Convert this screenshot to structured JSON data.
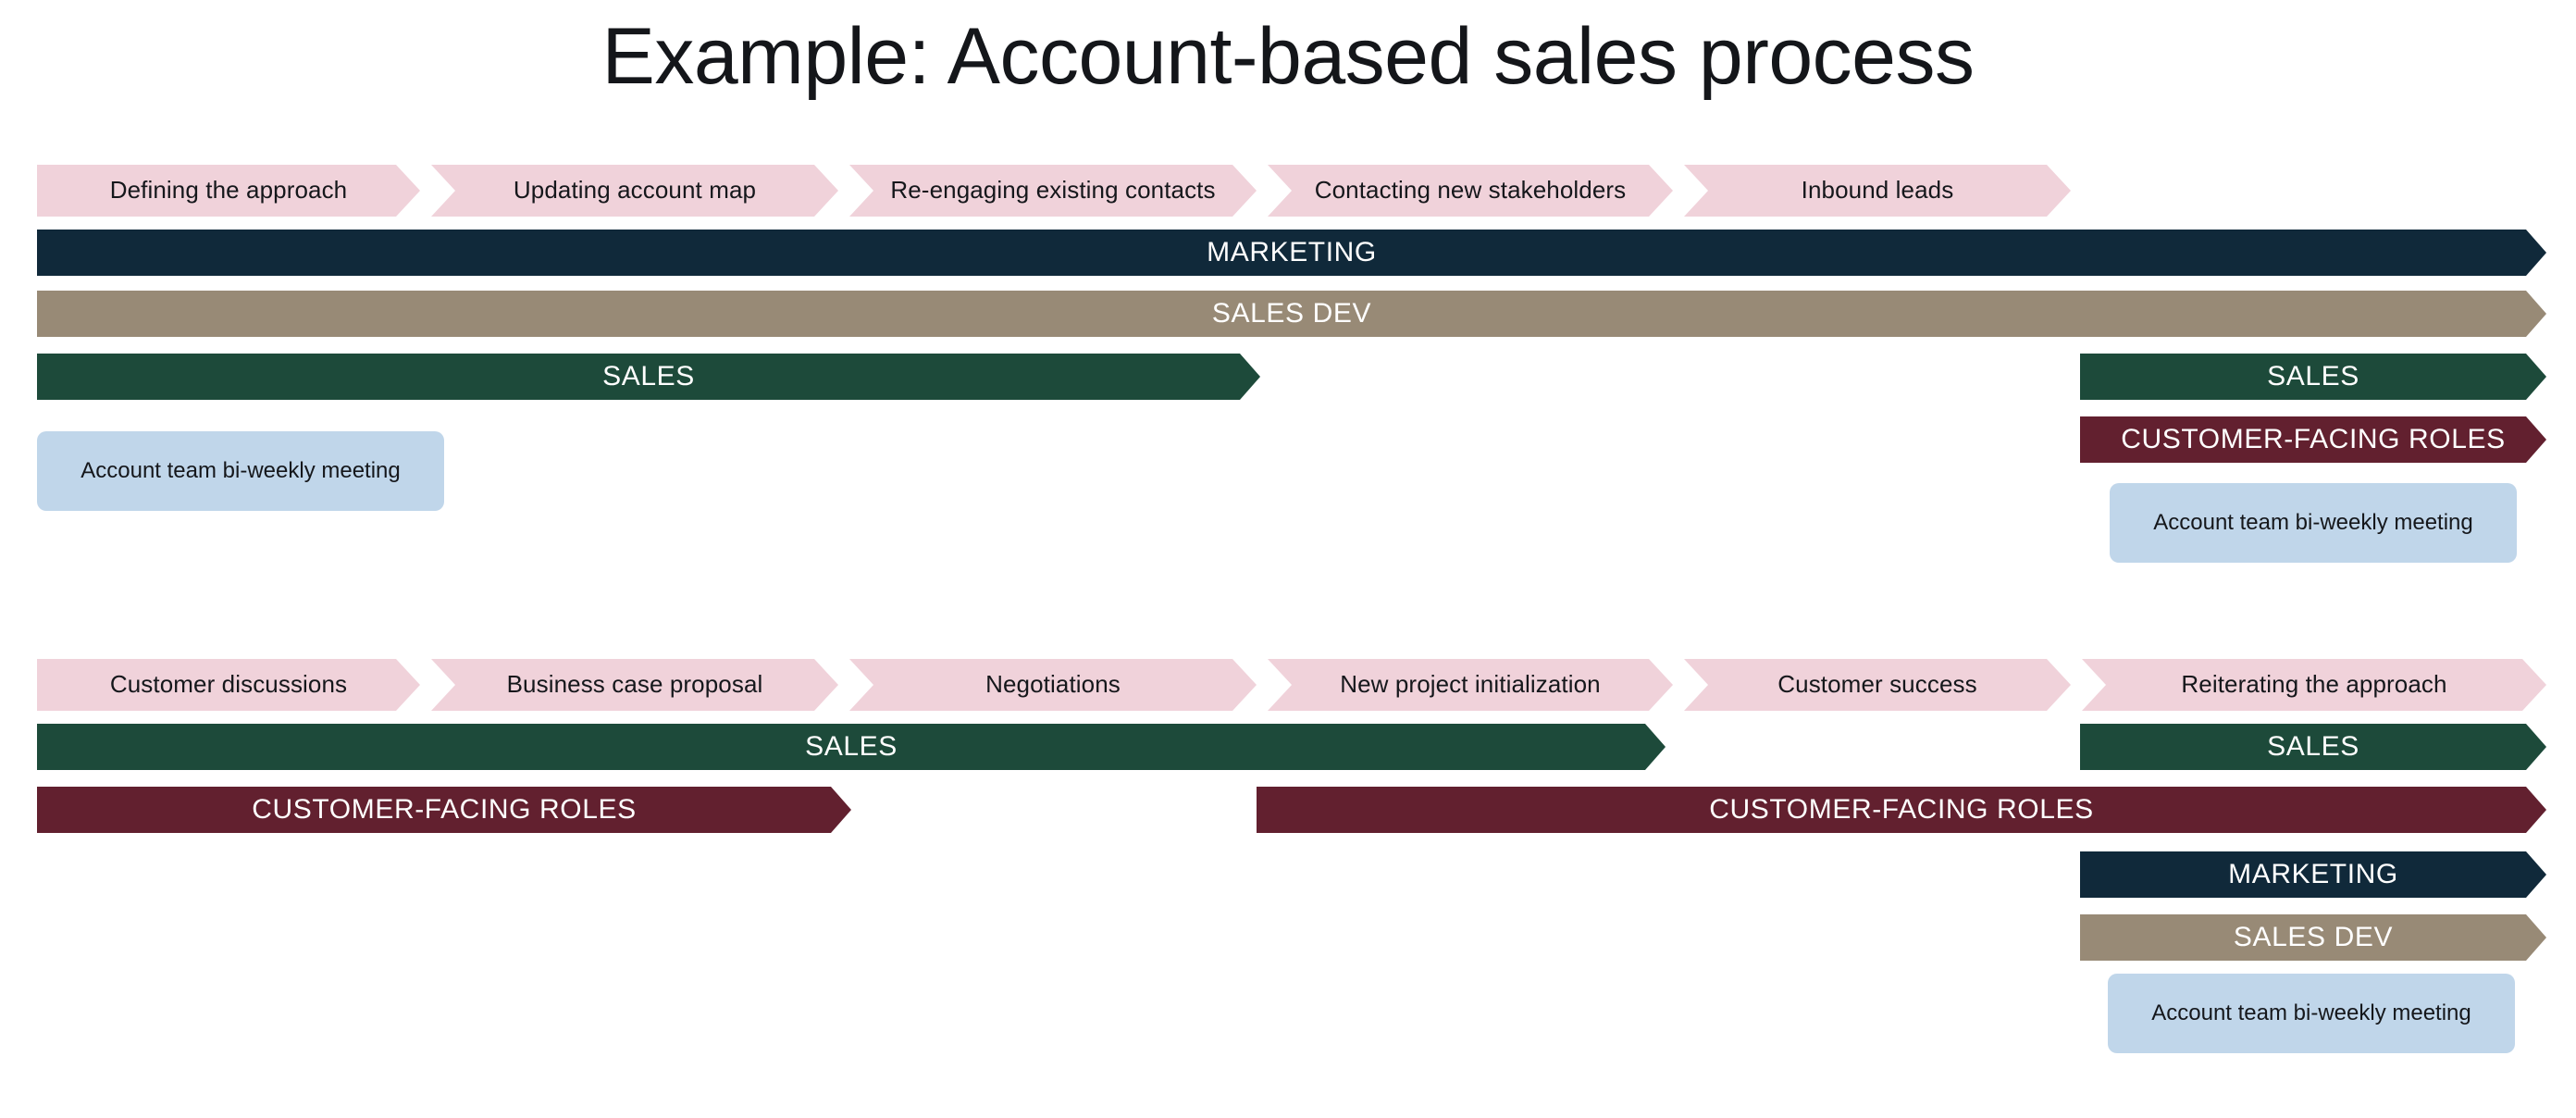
{
  "title": "Example: Account-based sales process",
  "colors": {
    "step": "#f0d2da",
    "marketing": "#10293a",
    "sales_dev": "#988a76",
    "sales": "#1d4a3a",
    "customer_facing": "#62202f",
    "meeting_note": "#c0d6ea",
    "background": "#ffffff",
    "title_text": "#14161a"
  },
  "row1": {
    "steps": [
      {
        "label": "Defining the approach"
      },
      {
        "label": "Updating account map"
      },
      {
        "label": "Re-engaging existing contacts"
      },
      {
        "label": "Contacting new stakeholders"
      },
      {
        "label": "Inbound leads"
      }
    ],
    "bars": [
      {
        "label": "MARKETING",
        "role": "marketing"
      },
      {
        "label": "SALES DEV",
        "role": "sales_dev"
      },
      {
        "label": "SALES",
        "role": "sales"
      },
      {
        "label": "SALES",
        "role": "sales"
      },
      {
        "label": "CUSTOMER-FACING ROLES",
        "role": "customer_facing"
      }
    ],
    "notes": [
      {
        "label": "Account team bi-weekly meeting"
      },
      {
        "label": "Account team bi-weekly meeting"
      }
    ]
  },
  "row2": {
    "steps": [
      {
        "label": "Customer discussions"
      },
      {
        "label": "Business case proposal"
      },
      {
        "label": "Negotiations"
      },
      {
        "label": "New project initialization"
      },
      {
        "label": "Customer success"
      },
      {
        "label": "Reiterating the approach"
      }
    ],
    "bars": [
      {
        "label": "SALES",
        "role": "sales"
      },
      {
        "label": "SALES",
        "role": "sales"
      },
      {
        "label": "CUSTOMER-FACING ROLES",
        "role": "customer_facing"
      },
      {
        "label": "CUSTOMER-FACING ROLES",
        "role": "customer_facing"
      },
      {
        "label": "MARKETING",
        "role": "marketing"
      },
      {
        "label": "SALES DEV",
        "role": "sales_dev"
      }
    ],
    "notes": [
      {
        "label": "Account team bi-weekly meeting"
      }
    ]
  }
}
